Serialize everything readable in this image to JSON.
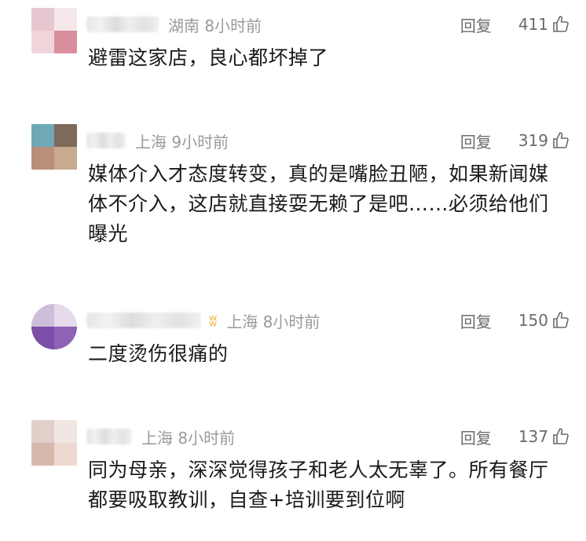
{
  "comments": [
    {
      "location": "湖南",
      "time": "8小时前",
      "location_time": "湖南 8小时前",
      "reply_label": "回复",
      "likes": "411",
      "text": "避雷这家店，良心都坏掉了",
      "icons": {
        "like": "thumbs-up-icon"
      }
    },
    {
      "location": "上海",
      "time": "9小时前",
      "location_time": "上海 9小时前",
      "reply_label": "回复",
      "likes": "319",
      "text": "媒体介入才态度转变，真的是嘴脸丑陋，如果新闻媒体不介入，这店就直接耍无赖了是吧……必须给他们曝光",
      "icons": {
        "like": "thumbs-up-icon"
      }
    },
    {
      "location": "上海",
      "time": "8小时前",
      "location_time": "上海 8小时前",
      "reply_label": "回复",
      "likes": "150",
      "text": "二度烫伤很痛的",
      "icons": {
        "like": "thumbs-up-icon",
        "badge": "fan-badge-icon"
      }
    },
    {
      "location": "上海",
      "time": "8小时前",
      "location_time": "上海 8小时前",
      "reply_label": "回复",
      "likes": "137",
      "text": "同为母亲，深深觉得孩子和老人太无辜了。所有餐厅都要吸取教训，自查+培训要到位啊",
      "icons": {
        "like": "thumbs-up-icon"
      }
    }
  ],
  "colors": {
    "text": "#1a1a1a",
    "meta": "#9a9a9a",
    "action": "#6b6b6b",
    "badge": "#f0b23c"
  }
}
